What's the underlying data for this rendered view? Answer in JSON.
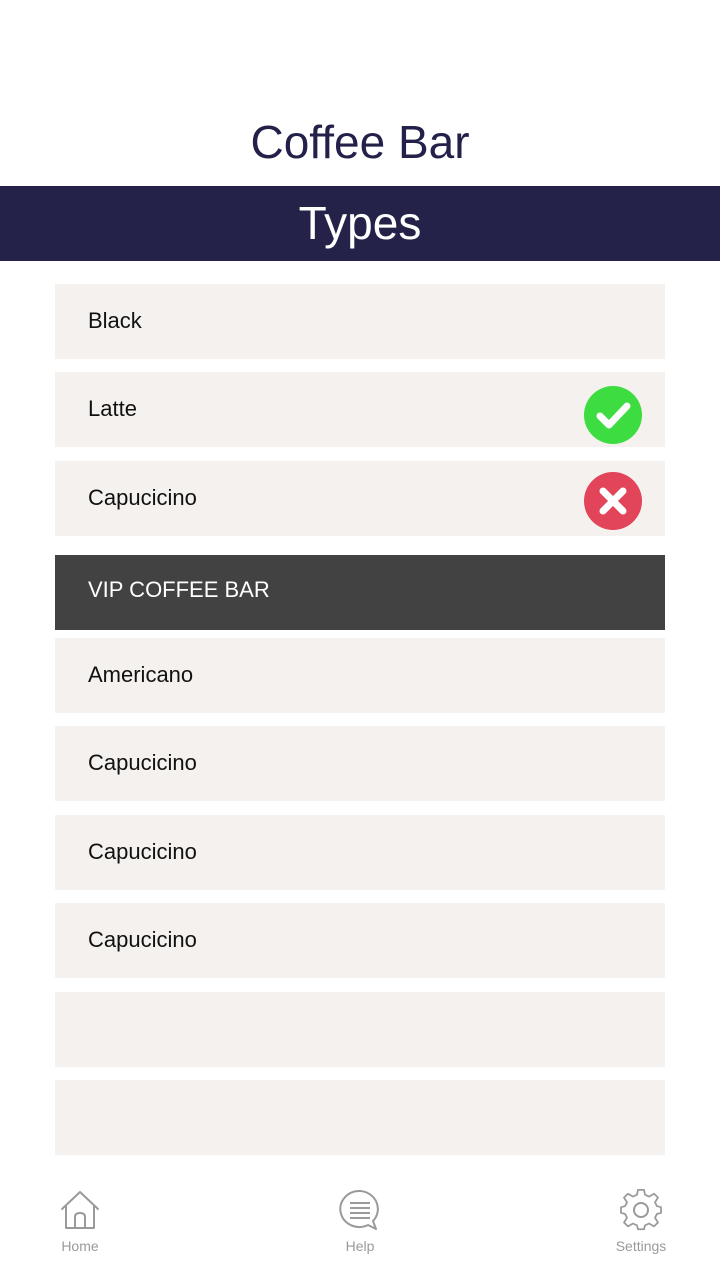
{
  "header": {
    "app_title": "Coffee Bar",
    "section_title": "Types"
  },
  "types": [
    {
      "label": "Black",
      "status": "none"
    },
    {
      "label": "Latte",
      "status": "available"
    },
    {
      "label": "Capucicino",
      "status": "unavailable"
    }
  ],
  "vip": {
    "title": "VIP COFFEE BAR",
    "items": [
      {
        "label": "Americano"
      },
      {
        "label": "Capucicino"
      },
      {
        "label": "Capucicino"
      },
      {
        "label": "Capucicino"
      },
      {
        "label": ""
      },
      {
        "label": ""
      }
    ]
  },
  "tabbar": {
    "home": {
      "label": "Home",
      "icon": "home-icon"
    },
    "help": {
      "label": "Help",
      "icon": "chat-bubble-icon"
    },
    "settings": {
      "label": "Settings",
      "icon": "gear-icon"
    }
  },
  "colors": {
    "brand_navy": "#242249",
    "row_bg": "#f4f1ee",
    "vip_header_bg": "#424242",
    "status_ok": "#3ddc40",
    "status_bad": "#e2445a"
  }
}
